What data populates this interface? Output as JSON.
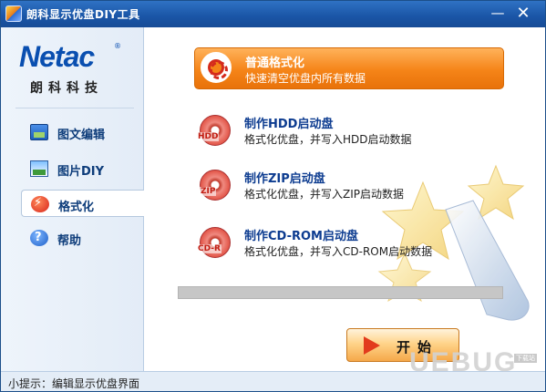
{
  "window": {
    "title": "朗科显示优盘DIY工具",
    "minimize_glyph": "—",
    "close_glyph": "✕"
  },
  "brand": {
    "logo_text": "Netac",
    "registered_mark": "®",
    "company_cn": "朗科科技"
  },
  "sidebar": {
    "items": [
      {
        "label": "图文编辑",
        "icon": "image-text-editor-icon",
        "active": false
      },
      {
        "label": "图片DIY",
        "icon": "picture-diy-icon",
        "active": false
      },
      {
        "label": "格式化",
        "icon": "format-icon",
        "active": true
      },
      {
        "label": "帮助",
        "icon": "help-icon",
        "active": false
      }
    ]
  },
  "options": [
    {
      "title": "普通格式化",
      "desc": "快速清空优盘内所有数据",
      "icon": "lifebuoy-icon",
      "selected": true
    },
    {
      "title": "制作HDD启动盘",
      "desc": "格式化优盘，并写入HDD启动数据",
      "icon": "hdd-disc-icon",
      "icon_label": "HDD",
      "selected": false
    },
    {
      "title": "制作ZIP启动盘",
      "desc": "格式化优盘，并写入ZIP启动数据",
      "icon": "zip-disc-icon",
      "icon_label": "ZIP",
      "selected": false
    },
    {
      "title": "制作CD-ROM启动盘",
      "desc": "格式化优盘，并写入CD-ROM启动数据",
      "icon": "cdrom-disc-icon",
      "icon_label": "CD-R",
      "selected": false
    }
  ],
  "progress": {
    "value": 0
  },
  "start_button": {
    "label": "开始"
  },
  "status": {
    "hint": "小提示：编辑显示优盘界面"
  },
  "watermark": {
    "text": "UEBUG",
    "sub": "下载站"
  },
  "colors": {
    "titlebar": "#1a55a6",
    "accent_orange": "#f58418",
    "nav_text": "#0d3c7a",
    "option_title": "#0d3c90"
  }
}
